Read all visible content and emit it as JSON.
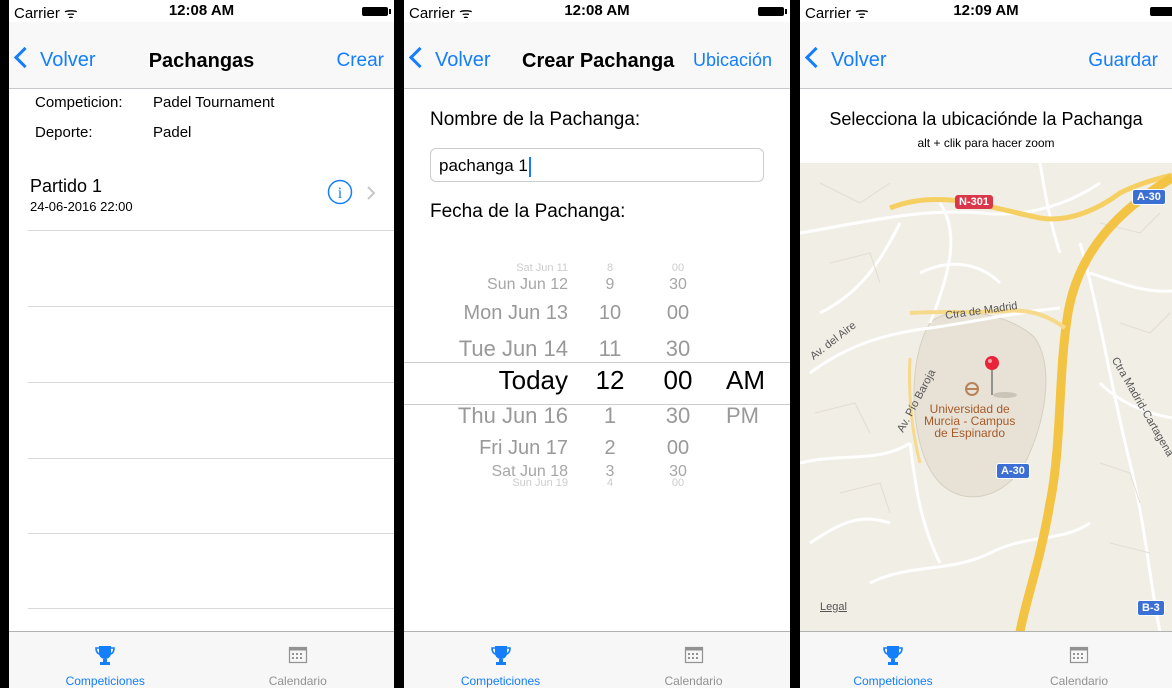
{
  "status": {
    "carrier": "Carrier",
    "times": [
      "12:08 AM",
      "12:08 AM",
      "12:09 AM"
    ]
  },
  "screen1": {
    "nav": {
      "back": "Volver",
      "title": "Pachangas",
      "right": "Crear"
    },
    "info": [
      {
        "label": "Competicion:",
        "value": "Padel Tournament"
      },
      {
        "label": "Deporte:",
        "value": "Padel"
      }
    ],
    "match": {
      "title": "Partido 1",
      "date": "24-06-2016 22:00"
    }
  },
  "screen2": {
    "nav": {
      "back": "Volver",
      "title": "Crear Pachanga",
      "right": "Ubicación"
    },
    "name_label": "Nombre de la Pachanga:",
    "name_value": "pachanga 1",
    "date_label": "Fecha de la Pachanga:",
    "picker": {
      "dates": [
        "Sat Jun 11",
        "Sun Jun 12",
        "Mon Jun 13",
        "Tue Jun 14",
        "Today",
        "Thu Jun 16",
        "Fri Jun 17",
        "Sat Jun 18",
        "Sun Jun 19"
      ],
      "hours": [
        "8",
        "9",
        "10",
        "11",
        "12",
        "1",
        "2",
        "3",
        "4"
      ],
      "minutes": [
        "00",
        "30",
        "00",
        "30",
        "00",
        "30",
        "00",
        "30",
        "00"
      ],
      "ampm": [
        "AM",
        "PM"
      ]
    }
  },
  "screen3": {
    "nav": {
      "back": "Volver",
      "right": "Guardar"
    },
    "heading": "Selecciona la ubicaciónde la Pachanga",
    "subheading": "alt + clik para hacer zoom",
    "map": {
      "labels": {
        "n301": "N-301",
        "a30_top": "A-30",
        "a30_mid": "A-30",
        "b3": "B-3",
        "ctra_madrid": "Ctra de Madrid",
        "av_aire": "Av. del Aire",
        "av_pio": "Av. Pío Baroja",
        "ctra_madrid_cartagena": "Ctra Madrid-Cartagena",
        "university": [
          "Universidad de",
          "Murcia - Campus",
          "de Espinardo"
        ],
        "legal": "Legal"
      }
    }
  },
  "tabs": {
    "competiciones": "Competiciones",
    "calendario": "Calendario"
  },
  "colors": {
    "accent": "#147efb",
    "gray": "#929292"
  }
}
